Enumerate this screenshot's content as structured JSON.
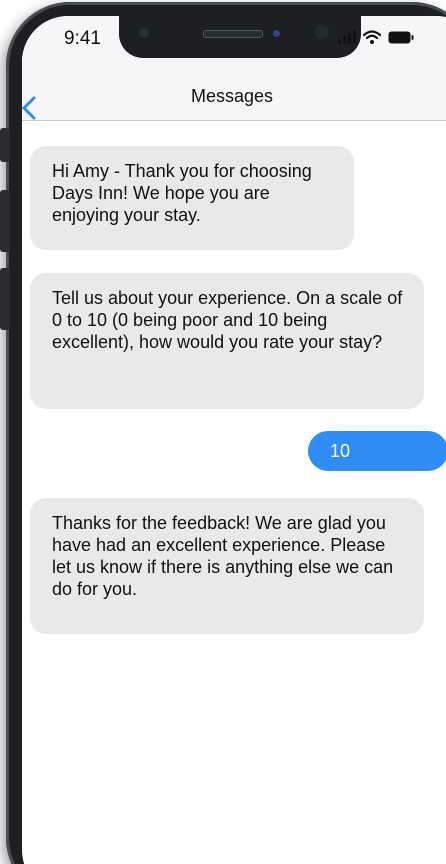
{
  "status_bar": {
    "time": "9:41"
  },
  "nav": {
    "title": "Messages",
    "back_icon": "chevron-left-icon"
  },
  "messages": [
    {
      "direction": "incoming",
      "text": "Hi Amy - Thank you for choosing Days Inn! We hope you are enjoying your stay."
    },
    {
      "direction": "incoming",
      "text": "Tell us about your experience. On a scale of 0 to 10 (0 being poor and 10 being excellent), how would you rate your stay?"
    },
    {
      "direction": "outgoing",
      "text": "10"
    },
    {
      "direction": "incoming",
      "text": "Thanks for the feedback! We are glad you have had an excellent experience. Please let us know if there is anything else we can do for you."
    }
  ],
  "colors": {
    "incoming_bubble": "#e9e9eb",
    "outgoing_bubble": "#2f8df5",
    "accent": "#2f8df5"
  },
  "icons": [
    "signal-icon",
    "wifi-icon",
    "battery-icon",
    "chevron-left-icon"
  ]
}
